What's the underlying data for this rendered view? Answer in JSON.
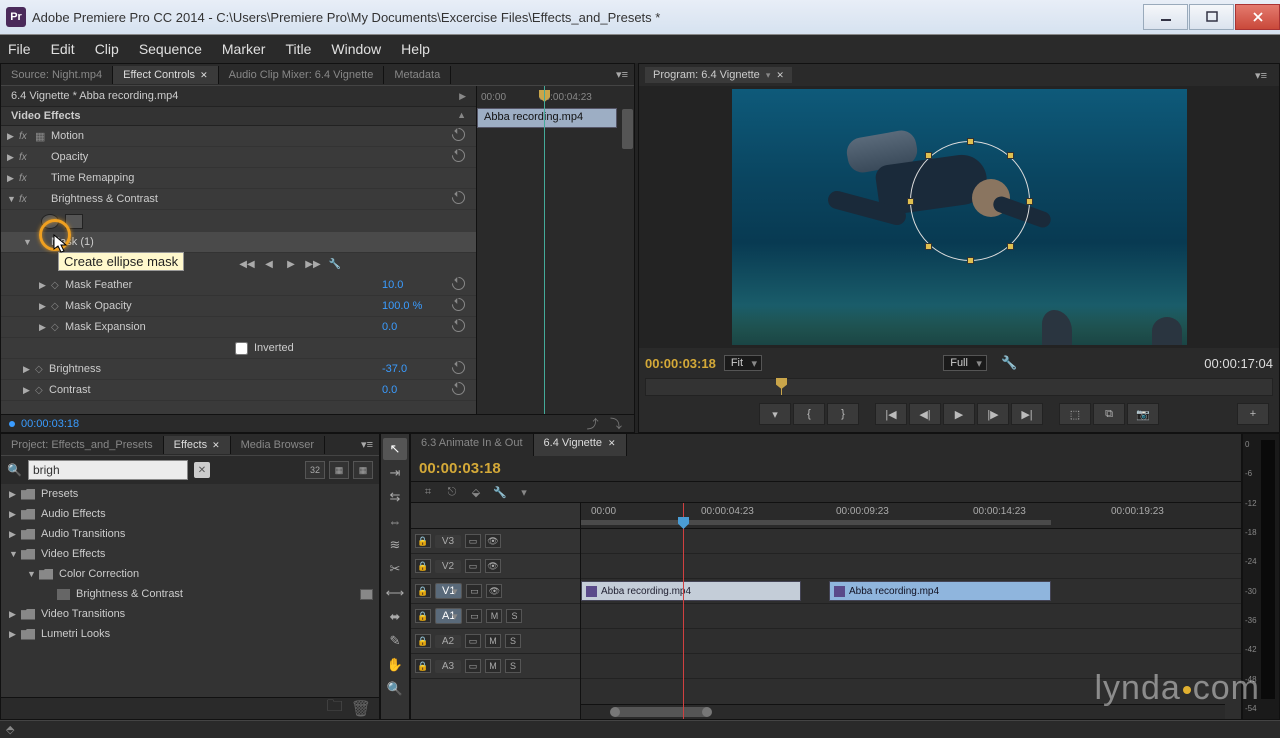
{
  "window": {
    "title": "Adobe Premiere Pro CC 2014 - C:\\Users\\Premiere Pro\\My Documents\\Excercise Files\\Effects_and_Presets *",
    "icon": "Pr"
  },
  "menubar": [
    "File",
    "Edit",
    "Clip",
    "Sequence",
    "Marker",
    "Title",
    "Window",
    "Help"
  ],
  "source_panel": {
    "tabs": [
      {
        "label": "Source: Night.mp4",
        "active": false
      },
      {
        "label": "Effect Controls",
        "active": true,
        "closeable": true
      },
      {
        "label": "Audio Clip Mixer: 6.4 Vignette",
        "active": false
      },
      {
        "label": "Metadata",
        "active": false
      }
    ],
    "clip_header": "6.4 Vignette * Abba recording.mp4",
    "section": "Video Effects",
    "effects": {
      "motion": "Motion",
      "opacity": "Opacity",
      "time_remap": "Time Remapping",
      "brightness": "Brightness & Contrast"
    },
    "tooltip": "Create ellipse mask",
    "mask": {
      "header": "Mask (1)",
      "feather": {
        "label": "Mask Feather",
        "value": "10.0"
      },
      "opacity": {
        "label": "Mask Opacity",
        "value": "100.0 %"
      },
      "expansion": {
        "label": "Mask Expansion",
        "value": "0.0"
      },
      "inverted": "Inverted"
    },
    "brightness": {
      "label": "Brightness",
      "value": "-37.0"
    },
    "contrast": {
      "label": "Contrast",
      "value": "0.0"
    },
    "timeline_clip": "Abba recording.mp4",
    "ruler_times": [
      "00:00",
      "00:00:04:23"
    ],
    "timecode": "00:00:03:18"
  },
  "program": {
    "tab": "Program: 6.4 Vignette",
    "tc_left": "00:00:03:18",
    "zoom": "Fit",
    "quality": "Full",
    "tc_right": "00:00:17:04"
  },
  "project_panel": {
    "tabs": [
      {
        "label": "Project: Effects_and_Presets",
        "active": false
      },
      {
        "label": "Effects",
        "active": true,
        "closeable": true
      },
      {
        "label": "Media Browser",
        "active": false
      }
    ],
    "search": "brigh",
    "tree": [
      {
        "label": "Presets",
        "depth": 0
      },
      {
        "label": "Audio Effects",
        "depth": 0
      },
      {
        "label": "Audio Transitions",
        "depth": 0
      },
      {
        "label": "Video Effects",
        "depth": 0,
        "open": true
      },
      {
        "label": "Color Correction",
        "depth": 1,
        "open": true
      },
      {
        "label": "Brightness & Contrast",
        "depth": 2,
        "leaf": true
      },
      {
        "label": "Video Transitions",
        "depth": 0
      },
      {
        "label": "Lumetri Looks",
        "depth": 0
      }
    ]
  },
  "timeline": {
    "tabs": [
      {
        "label": "6.3 Animate In & Out",
        "active": false
      },
      {
        "label": "6.4 Vignette",
        "active": true,
        "closeable": true
      }
    ],
    "timecode": "00:00:03:18",
    "ruler": [
      "00:00",
      "00:00:04:23",
      "00:00:09:23",
      "00:00:14:23",
      "00:00:19:23"
    ],
    "tracks": {
      "v3": "V3",
      "v2": "V2",
      "v1": "V1",
      "a1": "A1",
      "a2": "A2",
      "a3": "A3",
      "m": "M",
      "s": "S"
    },
    "clip1": "Abba recording.mp4",
    "clip2": "Abba recording.mp4"
  },
  "meter_labels": [
    "0",
    "-6",
    "-12",
    "-18",
    "-24",
    "-30",
    "-36",
    "-42",
    "-48",
    "-54"
  ],
  "watermark": "lynda.com"
}
